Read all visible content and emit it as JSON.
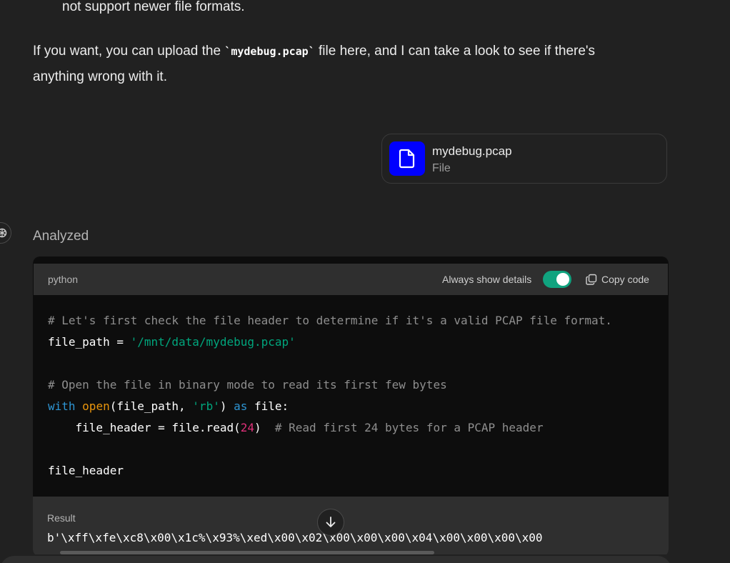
{
  "message": {
    "prev_line": "not support newer file formats.",
    "para_before": "If you want, you can upload the ",
    "para_code": "`mydebug.pcap`",
    "para_after": " file here, and I can take a look to see if there's anything wrong with it."
  },
  "attachment": {
    "icon": "file-icon",
    "icon_bg": "#0000ff",
    "name": "mydebug.pcap",
    "type": "File"
  },
  "analysis": {
    "status": "Analyzed",
    "assistant_icon": "openai-logo-icon"
  },
  "code_block": {
    "language": "python",
    "always_show_label": "Always show details",
    "always_show_on": true,
    "toggle_color": "#10a37f",
    "copy_label": "Copy code",
    "lines": {
      "l1_comment": "# Let's first check the file header to determine if it's a valid PCAP file format.",
      "l2_var": "file_path = ",
      "l2_str": "'/mnt/data/mydebug.pcap'",
      "l4_comment": "# Open the file in binary mode to read its first few bytes",
      "l5_with": "with",
      "l5_open": "open",
      "l5_args": "(file_path, ",
      "l5_str": "'rb'",
      "l5_close": ") ",
      "l5_as": "as",
      "l5_rest": " file:",
      "l6_pre": "    file_header = file.read(",
      "l6_num": "24",
      "l6_close": ")  ",
      "l6_comment": "# Read first 24 bytes for a PCAP header",
      "l8": "file_header"
    },
    "result_label": "Result",
    "result_value": "b'\\xff\\xfe\\xc8\\x00\\x1c%\\x93%\\xed\\x00\\x02\\x00\\x00\\x00\\x04\\x00\\x00\\x00\\x00"
  },
  "controls": {
    "scroll_down_icon": "arrow-down-icon",
    "copy_icon": "copy-icon"
  }
}
